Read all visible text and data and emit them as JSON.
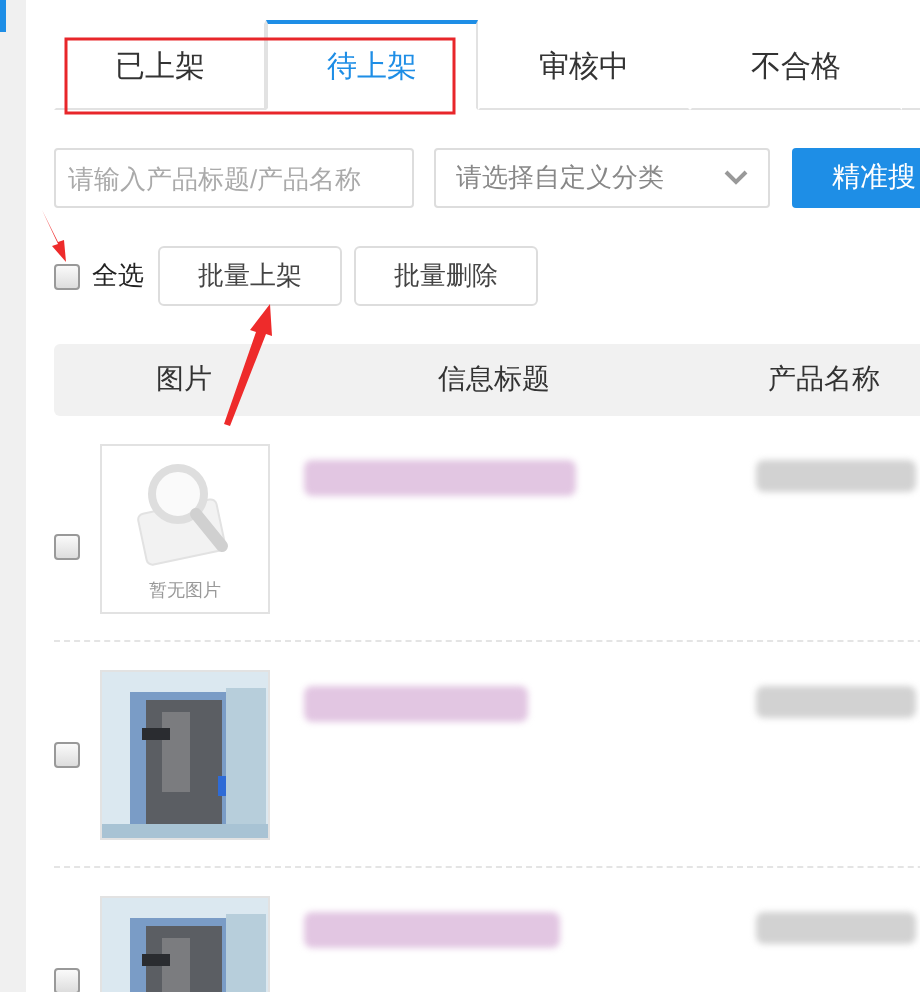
{
  "tabs": [
    {
      "label": "已上架",
      "selected": false
    },
    {
      "label": "待上架",
      "selected": true
    },
    {
      "label": "审核中",
      "selected": false
    },
    {
      "label": "不合格",
      "selected": false
    }
  ],
  "search": {
    "placeholder": "请输入产品标题/产品名称",
    "category_placeholder": "请选择自定义分类",
    "button": "精准搜"
  },
  "actions": {
    "select_all": {
      "label": "全选",
      "checked": false
    },
    "buttons": [
      "批量上架",
      "批量删除"
    ]
  },
  "table": {
    "columns": [
      "图片",
      "信息标题",
      "产品名称"
    ],
    "rows": [
      {
        "checked": false,
        "image": {
          "kind": "placeholder",
          "caption": "暂无图片"
        }
      },
      {
        "checked": false
      },
      {
        "checked": false
      }
    ]
  }
}
